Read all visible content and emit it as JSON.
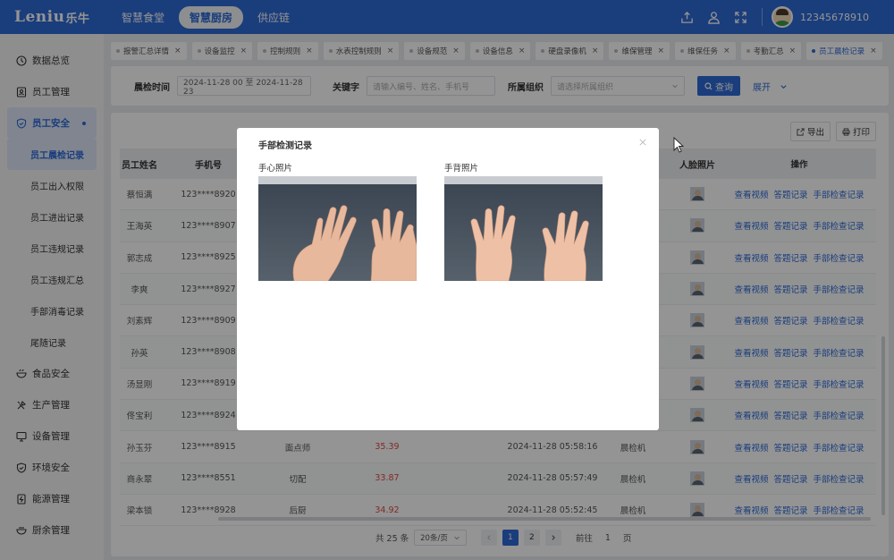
{
  "header": {
    "logo_main": "Leniu",
    "logo_cn": "乐牛",
    "nav": [
      "智慧食堂",
      "智慧厨房",
      "供应链"
    ],
    "active_nav": 1,
    "username": "12345678910",
    "icons": [
      "upload-icon",
      "user-icon",
      "fullscreen-icon"
    ]
  },
  "sidebar": {
    "items": [
      {
        "label": "数据总览",
        "icon": "clock-icon"
      },
      {
        "label": "员工管理",
        "icon": "id-card-icon"
      },
      {
        "label": "员工安全",
        "icon": "shield-icon"
      }
    ],
    "sub_items": [
      "员工晨检记录",
      "员工出入权限",
      "员工进出记录",
      "员工违规记录",
      "员工违规汇总",
      "手部消毒记录",
      "尾随记录"
    ],
    "active_sub": 0,
    "items_after": [
      {
        "label": "食品安全",
        "icon": "bowl-icon"
      },
      {
        "label": "生产管理",
        "icon": "tools-icon"
      },
      {
        "label": "设备管理",
        "icon": "monitor-icon"
      },
      {
        "label": "环境安全",
        "icon": "shield-check-icon"
      },
      {
        "label": "能源管理",
        "icon": "energy-icon"
      },
      {
        "label": "厨余管理",
        "icon": "waste-icon"
      }
    ]
  },
  "tabs": [
    {
      "label": "报警汇总详情"
    },
    {
      "label": "设备监控"
    },
    {
      "label": "控制规则"
    },
    {
      "label": "水表控制规则"
    },
    {
      "label": "设备规范"
    },
    {
      "label": "设备信息"
    },
    {
      "label": "硬盘录像机"
    },
    {
      "label": "维保管理"
    },
    {
      "label": "维保任务"
    },
    {
      "label": "考勤汇总"
    },
    {
      "label": "员工晨检记录",
      "active": true
    }
  ],
  "filter": {
    "time_label": "晨检时间",
    "time_value": "2024-11-28 00 至 2024-11-28 23",
    "keyword_label": "关键字",
    "keyword_placeholder": "请输入编号、姓名、手机号",
    "org_label": "所属组织",
    "org_placeholder": "请选择所属组织",
    "query_label": "查询",
    "expand_label": "展开"
  },
  "toolbar": {
    "export_label": "导出",
    "print_label": "打印"
  },
  "table": {
    "headers": {
      "name": "员工姓名",
      "phone": "手机号",
      "face": "人脸照片",
      "ops": "操作"
    },
    "op_labels": [
      "查看视频",
      "答题记录",
      "手部检查记录"
    ],
    "rows": [
      {
        "name": "蔡恒满",
        "phone": "123****8920",
        "position": "",
        "temp": "",
        "time": "",
        "device": ""
      },
      {
        "name": "王海英",
        "phone": "123****8907",
        "position": "",
        "temp": "",
        "time": "",
        "device": ""
      },
      {
        "name": "郭志成",
        "phone": "123****8925",
        "position": "",
        "temp": "",
        "time": "",
        "device": ""
      },
      {
        "name": "李爽",
        "phone": "123****8927",
        "position": "",
        "temp": "",
        "time": "",
        "device": ""
      },
      {
        "name": "刘素辉",
        "phone": "123****8909",
        "position": "",
        "temp": "",
        "time": "",
        "device": ""
      },
      {
        "name": "孙英",
        "phone": "123****8908",
        "position": "",
        "temp": "",
        "time": "",
        "device": ""
      },
      {
        "name": "汤显刚",
        "phone": "123****8919",
        "position": "",
        "temp": "",
        "time": "",
        "device": ""
      },
      {
        "name": "佟宝利",
        "phone": "123****8924",
        "position": "",
        "temp": "",
        "time": "",
        "device": ""
      },
      {
        "name": "孙玉芬",
        "phone": "123****8915",
        "position": "面点师",
        "temp": "35.39",
        "time": "2024-11-28 05:58:16",
        "device": "晨检机"
      },
      {
        "name": "商永翠",
        "phone": "123****8551",
        "position": "切配",
        "temp": "33.87",
        "time": "2024-11-28 05:57:49",
        "device": "晨检机"
      },
      {
        "name": "梁本锁",
        "phone": "123****8928",
        "position": "后厨",
        "temp": "34.92",
        "time": "2024-11-28 05:52:45",
        "device": "晨检机"
      }
    ]
  },
  "pager": {
    "total": "共 25 条",
    "page_size": "20条/页",
    "pages": [
      "1",
      "2"
    ],
    "current": 0,
    "goto_prefix": "前往",
    "goto_value": "1",
    "goto_suffix": "页"
  },
  "modal": {
    "title": "手部检测记录",
    "palm_label": "手心照片",
    "back_label": "手背照片"
  }
}
